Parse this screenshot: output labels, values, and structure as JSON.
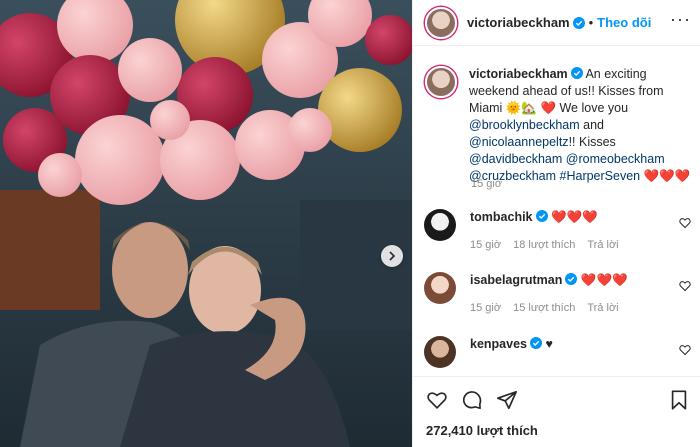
{
  "header": {
    "username": "victoriabeckham",
    "separator": "•",
    "follow_label": "Theo dõi",
    "more_label": "···"
  },
  "caption": {
    "username": "victoriabeckham",
    "part1": " An exciting weekend ahead of us!! Kisses from Miami ",
    "emoji1": "🌞🏡",
    "heart1": "❤️",
    "part2": " We love you ",
    "mention1": "@brooklynbeckham",
    "part3": " and ",
    "mention2": "@nicolaannepeltz",
    "part4": "!! Kisses ",
    "mention3": "@davidbeckham",
    "mention4": "@romeobeckham",
    "mention5": "@cruzbeckham",
    "mention6": "#HarperSeven",
    "hearts_end": "❤️❤️❤️",
    "time": "15 giờ"
  },
  "comments": [
    {
      "username": "tombachik",
      "text": "❤️❤️❤️",
      "time": "15 giờ",
      "likes": "18 lượt thích",
      "reply": "Trả lời"
    },
    {
      "username": "isabelagrutman",
      "text": "❤️❤️❤️",
      "time": "15 giờ",
      "likes": "15 lượt thích",
      "reply": "Trả lời"
    },
    {
      "username": "kenpaves",
      "text": "♥",
      "time": "",
      "likes": "",
      "reply": ""
    }
  ],
  "footer": {
    "likes_count": "272,410 lượt thích"
  },
  "icons": {
    "verified": "verified-badge-icon",
    "heart": "heart-icon",
    "comment": "comment-icon",
    "share": "share-icon",
    "save": "bookmark-icon",
    "next": "chevron-right-icon"
  },
  "colors": {
    "accent": "#0095f6",
    "mention": "#00376b",
    "muted": "#8e8e8e",
    "heart": "#ed1c24"
  }
}
